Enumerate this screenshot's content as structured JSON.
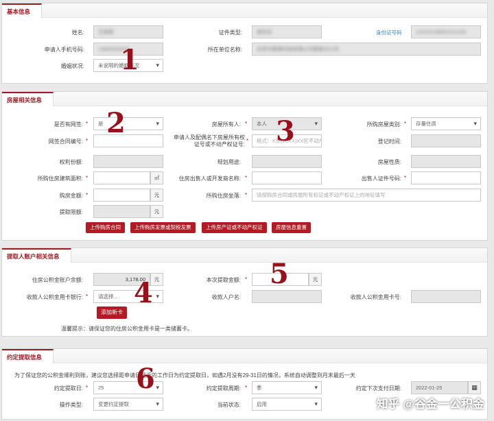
{
  "basic": {
    "title": "基本信息",
    "name_label": "姓名:",
    "name_value": "王某某",
    "id_type_label": "证件类型:",
    "id_type_value": "身份证",
    "id_link": "身份证号码",
    "id_number_value": "110101199001011234",
    "phone_label": "申请人手机号码:",
    "phone_value": "13800000000",
    "company_label": "所在单位名称:",
    "company_value": "北京市某某科技有限公司某某分公司",
    "marital_label": "婚姻状况:",
    "marital_value": "未说明的婚姻状况"
  },
  "house": {
    "title": "房屋相关信息",
    "online_label": "是否有网签:",
    "online_value": "是",
    "owner_label": "房屋所有人:",
    "owner_value": "本人",
    "type_label": "所购房屋类别:",
    "type_value": "存量住房",
    "contract_label": "网签合同编号:",
    "cert_label": "申请人及配偶名下房屋所有权证号或不动产权证号:",
    "cert_placeholder": "格式：X京(20XX)XX区不动产权第XXXXXXX号",
    "register_label": "登记时间:",
    "share_label": "权利份额:",
    "usage_label": "规划用途:",
    "nature_label": "房屋性质:",
    "area_label": "所购住房建筑面积:",
    "area_unit": "㎡",
    "seller_label": "住房出售人或开发商名称:",
    "seller_id_label": "出售人证件号码:",
    "amount_label": "购房金额:",
    "amount_unit": "元",
    "address_label": "所购住房坐落:",
    "address_placeholder": "请按购房合同或房屋所有权证或不动产权证上的地址填写",
    "limit_label": "提取限额:",
    "limit_unit": "元",
    "buttons": [
      "上传购房合同",
      "上传购房发票或契税发票",
      "上传房产证或不动产权证",
      "房屋信息重置"
    ]
  },
  "account": {
    "title": "提取人账户相关信息",
    "balance_label": "住房公积金账户余额:",
    "balance_value": "3,178.00",
    "balance_unit": "元",
    "this_amount_label": "本次提取金额:",
    "this_amount_unit": "元",
    "bank_label": "收款人公积金用卡银行:",
    "bank_placeholder": "请选择...",
    "payee_label": "收款人户名:",
    "card_label": "收款人公积金用卡号:",
    "add_card": "添加新卡",
    "tip": "温馨提示：请保证您的住房公积金用卡是一类储蓄卡。"
  },
  "agreed": {
    "title": "约定提取信息",
    "note": "为了保证您的公积金顺利到账，建议您选择距申请日最近的工作日为约定提取日，如遇2月没有29-31日的情况，系统自动调整到月末最后一天",
    "day_label": "约定提取日:",
    "day_value": "25",
    "cycle_label": "约定提取周期:",
    "cycle_value": "季",
    "next_label": "约定下次支付日期:",
    "next_value": "2022-01-25",
    "op_label": "操作类型:",
    "op_value": "变更约定提取",
    "status_label": "当前状态:",
    "status_value": "启用"
  },
  "markers": [
    "1",
    "2",
    "3",
    "4",
    "5",
    "6"
  ],
  "watermark": "知乎 @谷金一公积金",
  "colors": {
    "accent": "#a01a22",
    "button": "#b51a24",
    "link": "#3a86c8"
  }
}
